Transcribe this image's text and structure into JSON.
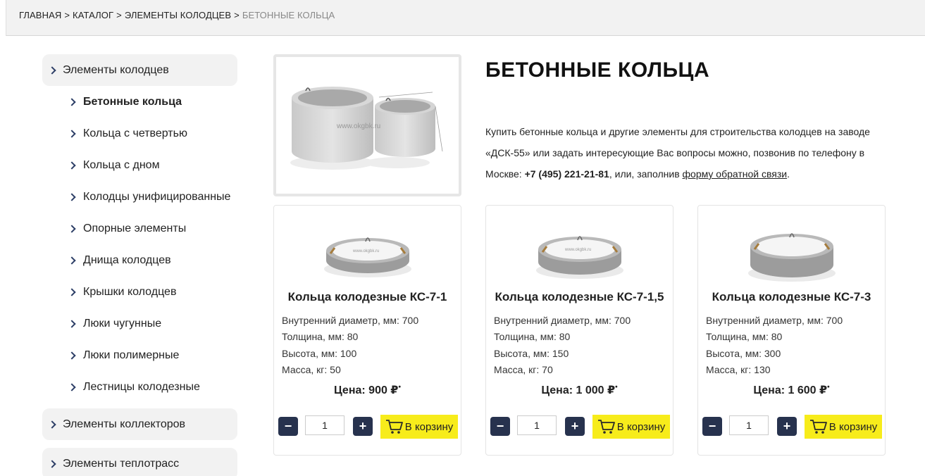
{
  "breadcrumb": {
    "items": [
      "ГЛАВНАЯ",
      "КАТАЛОГ",
      "ЭЛЕМЕНТЫ КОЛОДЦЕВ"
    ],
    "separator": ">",
    "current": "БЕТОННЫЕ КОЛЬЦА"
  },
  "sidebar": {
    "group1": "Элементы колодцев",
    "subitems": [
      "Бетонные кольца",
      "Кольца с четвертью",
      "Кольца с дном",
      "Колодцы унифицированные",
      "Опорные элементы",
      "Днища колодцев",
      "Крышки колодцев",
      "Люки чугунные",
      "Люки полимерные",
      "Лестницы колодезные"
    ],
    "group2": "Элементы коллекторов",
    "group3": "Элементы теплотрасс"
  },
  "page": {
    "title": "БЕТОННЫЕ КОЛЬЦА",
    "intro_part1": "Купить бетонные кольца и другие элементы для строительства колодцев на заводе «ДСК-55» или задать интересующие Вас вопросы можно, позвонив по телефону в Москве: ",
    "phone": "+7 (495) 221-21-81",
    "intro_part2": ", или, заполнив ",
    "feedback_link": "форму обратной связи",
    "intro_part3": ".",
    "watermark": "www.okgbk.ru"
  },
  "products": [
    {
      "title": "Кольца колодезные КС-7-1",
      "spec1": "Внутренний диаметр, мм: 700",
      "spec2": "Толщина, мм: 80",
      "spec3": "Высота, мм: 100",
      "spec4": "Масса, кг: 50",
      "price": "Цена: 900 ₽",
      "qty": "1",
      "cart": "В корзину"
    },
    {
      "title": "Кольца колодезные КС-7-1,5",
      "spec1": "Внутренний диаметр, мм: 700",
      "spec2": "Толщина, мм: 80",
      "spec3": "Высота, мм: 150",
      "spec4": "Масса, кг: 70",
      "price": "Цена: 1 000 ₽",
      "qty": "1",
      "cart": "В корзину"
    },
    {
      "title": "Кольца колодезные КС-7-3",
      "spec1": "Внутренний диаметр, мм: 700",
      "spec2": "Толщина, мм: 80",
      "spec3": "Высота, мм: 300",
      "spec4": "Масса, кг: 130",
      "price": "Цена: 1 600 ₽",
      "qty": "1",
      "cart": "В корзину"
    }
  ],
  "colors": {
    "accent_dark": "#27324e",
    "cart_yellow": "#f7ec1b"
  }
}
